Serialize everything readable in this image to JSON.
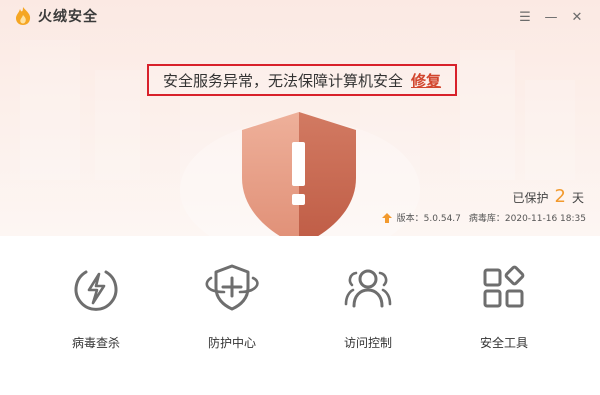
{
  "app": {
    "name": "火绒安全"
  },
  "window_controls": {
    "menu_icon": "menu-icon",
    "minimize_icon": "minimize-icon",
    "close_icon": "close-icon",
    "menu_glyph": "☰",
    "minimize_glyph": "—",
    "close_glyph": "✕"
  },
  "alert": {
    "message": "安全服务异常，无法保障计算机安全",
    "fix_label": "修复",
    "border_color": "#d8202a"
  },
  "status": {
    "protect_prefix": "已保护",
    "protect_days": "2",
    "protect_suffix": "天",
    "version_label": "版本：5.0.54.7",
    "virus_db_label": "病毒库：2020-11-16 18:35"
  },
  "features": [
    {
      "label": "病毒查杀",
      "icon": "lightning-circle-icon"
    },
    {
      "label": "防护中心",
      "icon": "shield-plus-orbit-icon"
    },
    {
      "label": "访问控制",
      "icon": "users-icon"
    },
    {
      "label": "安全工具",
      "icon": "grid-tools-icon"
    }
  ],
  "colors": {
    "accent": "#f29a2e",
    "shield_light": "#e7a08a",
    "shield_dark": "#c8674f",
    "icon_gray": "#6e6e6e"
  }
}
